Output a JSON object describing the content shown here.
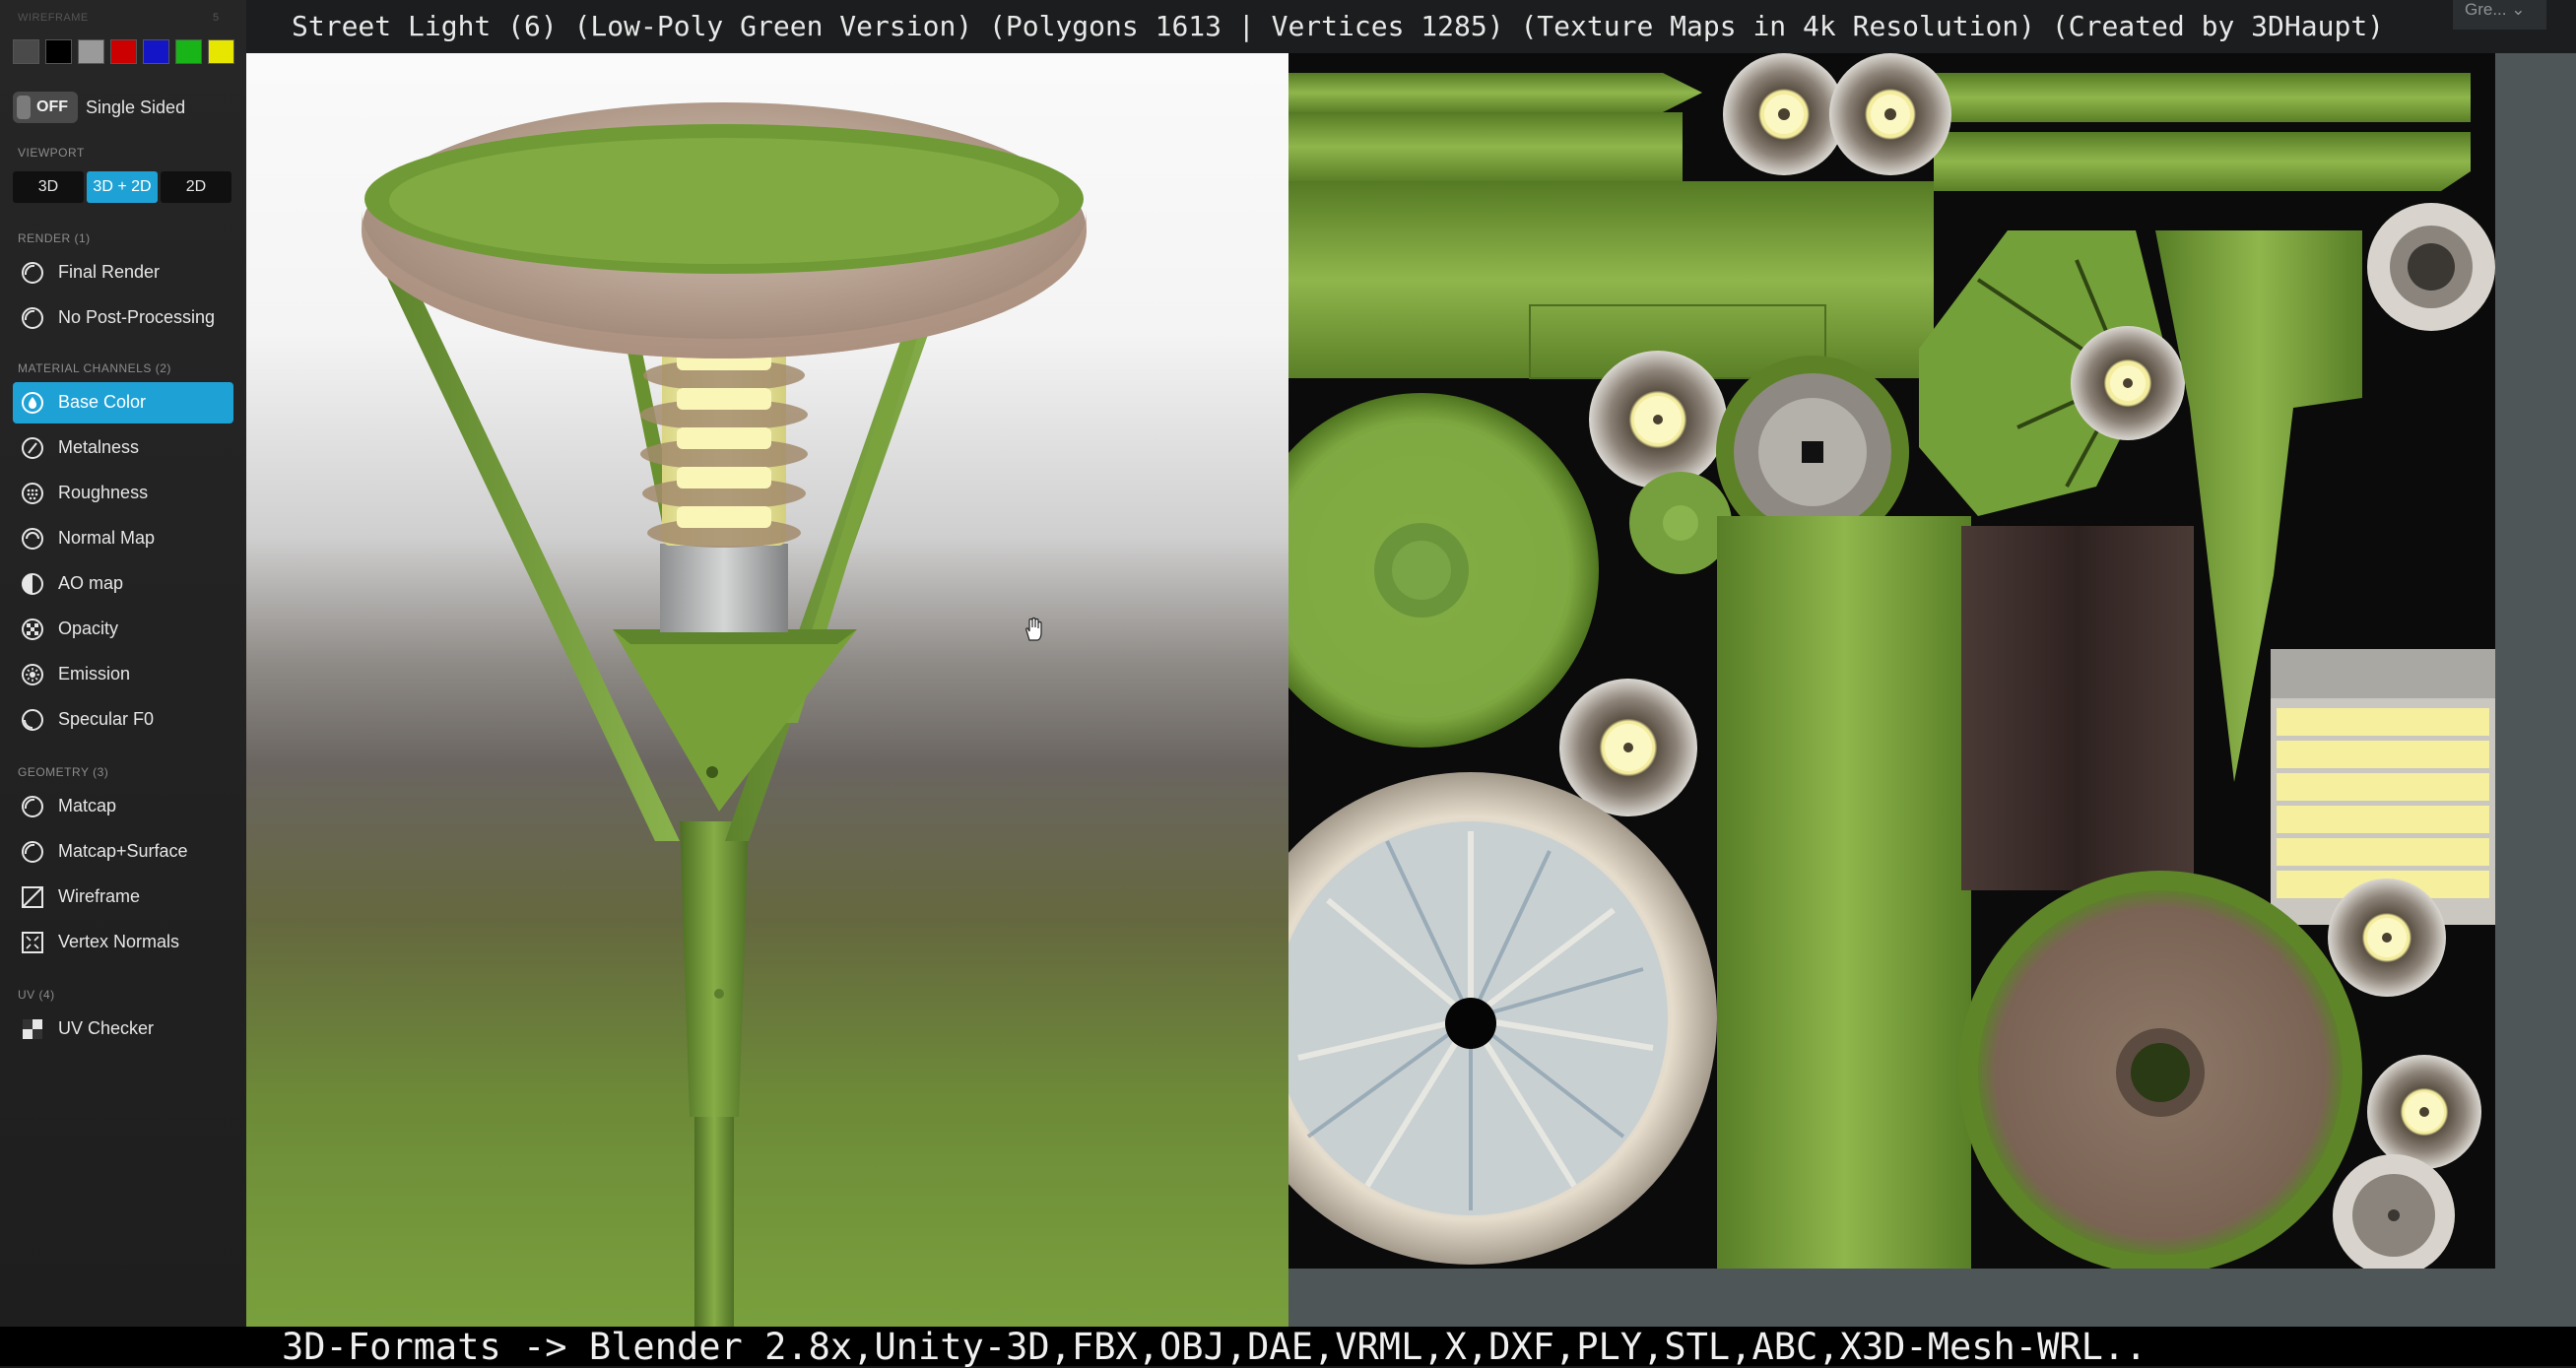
{
  "title": "Street Light (6) (Low-Poly Green Version) (Polygons 1613 | Vertices 1285) (Texture Maps in 4k Resolution) (Created by 3DHaupt)",
  "footer": "3D-Formats -> Blender 2.8x,Unity-3D,FBX,OBJ,DAE,VRML,X,DXF,PLY,STL,ABC,X3D-Mesh-WRL..",
  "corner_dropdown": "Gre...",
  "sidebar": {
    "wireframe_header": "WIREFRAME",
    "wireframe_counter": "5",
    "swatches": [
      "#4a4a4a",
      "#000000",
      "#9a9a9a",
      "#cc0000",
      "#1515c8",
      "#18b418",
      "#e6e600"
    ],
    "single_sided": {
      "state": "OFF",
      "label": "Single Sided"
    },
    "viewport": {
      "header": "VIEWPORT",
      "buttons": [
        "3D",
        "3D + 2D",
        "2D"
      ],
      "active": "3D + 2D"
    },
    "render": {
      "header": "RENDER (1)",
      "items": [
        "Final Render",
        "No Post-Processing"
      ]
    },
    "material": {
      "header": "MATERIAL CHANNELS (2)",
      "items": [
        "Base Color",
        "Metalness",
        "Roughness",
        "Normal Map",
        "AO map",
        "Opacity",
        "Emission",
        "Specular F0"
      ],
      "active": "Base Color"
    },
    "geometry": {
      "header": "GEOMETRY (3)",
      "items": [
        "Matcap",
        "Matcap+Surface",
        "Wireframe",
        "Vertex Normals"
      ]
    },
    "uv": {
      "header": "UV (4)",
      "items": [
        "UV Checker"
      ]
    }
  },
  "colors": {
    "accent": "#1ea2d6",
    "sidebar_bg": "#222222",
    "lamp_green": "#6f9a35",
    "lamp_shade": "#c2a89a",
    "bulb": "#f4f0a8"
  }
}
